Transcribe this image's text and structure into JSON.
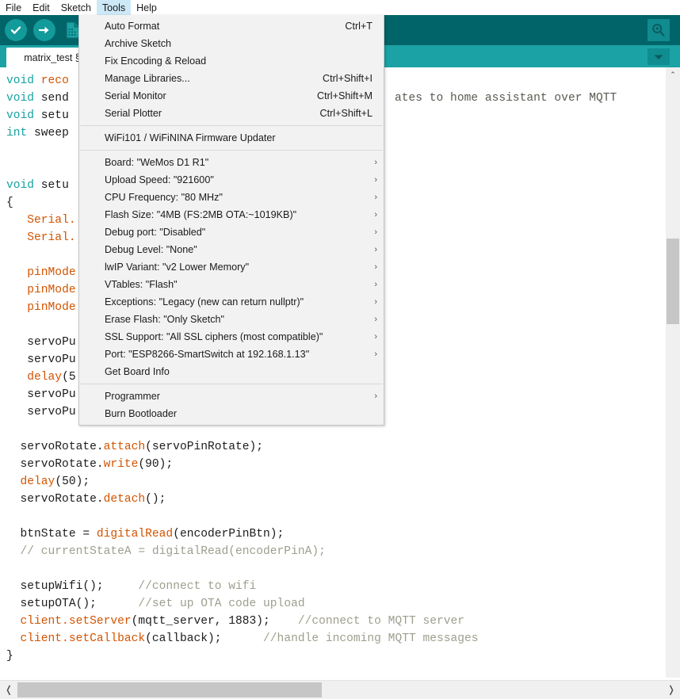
{
  "menubar": {
    "items": [
      {
        "label": "File",
        "active": false
      },
      {
        "label": "Edit",
        "active": false
      },
      {
        "label": "Sketch",
        "active": false
      },
      {
        "label": "Tools",
        "active": true
      },
      {
        "label": "Help",
        "active": false
      }
    ]
  },
  "toolbar": {
    "verify_title": "Verify",
    "upload_title": "Upload",
    "new_title": "New",
    "open_title": "Open",
    "serial_monitor_title": "Serial Monitor"
  },
  "tabbar": {
    "tab_label": "matrix_test §",
    "tab_menu_label": "▼"
  },
  "tools_menu": {
    "groups": [
      {
        "items": [
          {
            "label": "Auto Format",
            "accel": "Ctrl+T",
            "submenu": false
          },
          {
            "label": "Archive Sketch",
            "accel": "",
            "submenu": false
          },
          {
            "label": "Fix Encoding & Reload",
            "accel": "",
            "submenu": false
          },
          {
            "label": "Manage Libraries...",
            "accel": "Ctrl+Shift+I",
            "submenu": false
          },
          {
            "label": "Serial Monitor",
            "accel": "Ctrl+Shift+M",
            "submenu": false
          },
          {
            "label": "Serial Plotter",
            "accel": "Ctrl+Shift+L",
            "submenu": false
          }
        ]
      },
      {
        "items": [
          {
            "label": "WiFi101 / WiFiNINA Firmware Updater",
            "accel": "",
            "submenu": false
          }
        ]
      },
      {
        "items": [
          {
            "label": "Board: \"WeMos D1 R1\"",
            "accel": "",
            "submenu": true
          },
          {
            "label": "Upload Speed: \"921600\"",
            "accel": "",
            "submenu": true
          },
          {
            "label": "CPU Frequency: \"80 MHz\"",
            "accel": "",
            "submenu": true
          },
          {
            "label": "Flash Size: \"4MB (FS:2MB OTA:~1019KB)\"",
            "accel": "",
            "submenu": true
          },
          {
            "label": "Debug port: \"Disabled\"",
            "accel": "",
            "submenu": true
          },
          {
            "label": "Debug Level: \"None\"",
            "accel": "",
            "submenu": true
          },
          {
            "label": "lwIP Variant: \"v2 Lower Memory\"",
            "accel": "",
            "submenu": true
          },
          {
            "label": "VTables: \"Flash\"",
            "accel": "",
            "submenu": true
          },
          {
            "label": "Exceptions: \"Legacy (new can return nullptr)\"",
            "accel": "",
            "submenu": true
          },
          {
            "label": "Erase Flash: \"Only Sketch\"",
            "accel": "",
            "submenu": true
          },
          {
            "label": "SSL Support: \"All SSL ciphers (most compatible)\"",
            "accel": "",
            "submenu": true
          },
          {
            "label": "Port: \"ESP8266-SmartSwitch at 192.168.1.13\"",
            "accel": "",
            "submenu": true
          },
          {
            "label": "Get Board Info",
            "accel": "",
            "submenu": false
          }
        ]
      },
      {
        "items": [
          {
            "label": "Programmer",
            "accel": "",
            "submenu": true
          },
          {
            "label": "Burn Bootloader",
            "accel": "",
            "submenu": false
          }
        ]
      }
    ]
  },
  "editor": {
    "visible_comment_fragment": "ates to home assistant over MQTT",
    "lines_left_column": [
      "void reco",
      "void send",
      "void setu",
      "int sweep",
      "",
      "",
      "void setu",
      "{",
      "   Serial.",
      "   Serial.",
      "",
      "   pinMode",
      "   pinMode",
      "   pinMode",
      "",
      "   servoPu",
      "   servoPu",
      "   delay(5",
      "   servoPu",
      "   servoPu"
    ],
    "lines_full": [
      "  servoRotate.attach(servoPinRotate);",
      "  servoRotate.write(90);",
      "  delay(50);",
      "  servoRotate.detach();",
      "",
      "  btnState = digitalRead(encoderPinBtn);",
      "  // currentStateA = digitalRead(encoderPinA);",
      "",
      "  setupWifi();     //connect to wifi",
      "  setupOTA();      //set up OTA code upload",
      "  client.setServer(mqtt_server, 1883);    //connect to MQTT server",
      "  client.setCallback(callback);      //handle incoming MQTT messages",
      "}"
    ]
  },
  "scrollbars": {
    "v_up_arrow": "⌃",
    "h_left_arrow": "❬",
    "h_right_arrow": "❭"
  },
  "colors": {
    "toolbar_bg": "#006468",
    "tabbar_bg": "#1aa2a4",
    "menu_bg": "#f2f2f2",
    "menu_highlight": "#cde8f6",
    "keyword": "#17a1a1",
    "function": "#d35400",
    "comment": "#9e9e8e",
    "code_text": "#1c1c1c",
    "scrollbar_thumb": "#c6c6c6"
  }
}
